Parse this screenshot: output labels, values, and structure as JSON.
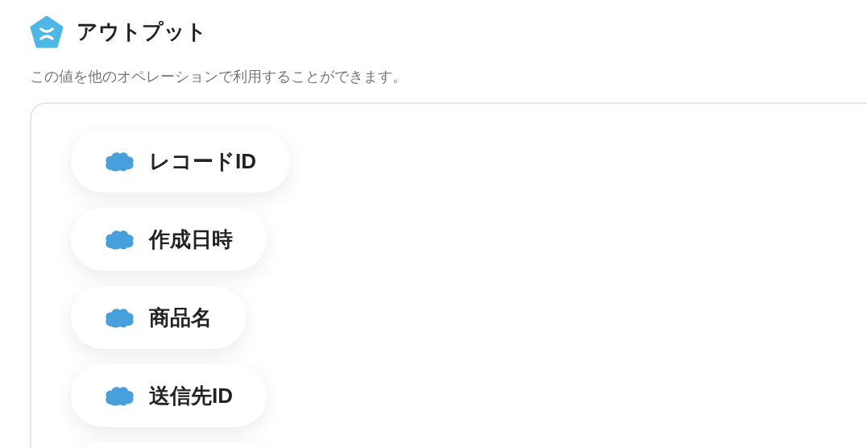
{
  "header": {
    "title": "アウトプット",
    "description": "この値を他のオペレーションで利用することができます。"
  },
  "outputs": [
    {
      "label": "レコードID"
    },
    {
      "label": "作成日時"
    },
    {
      "label": "商品名"
    },
    {
      "label": "送信先ID"
    }
  ]
}
